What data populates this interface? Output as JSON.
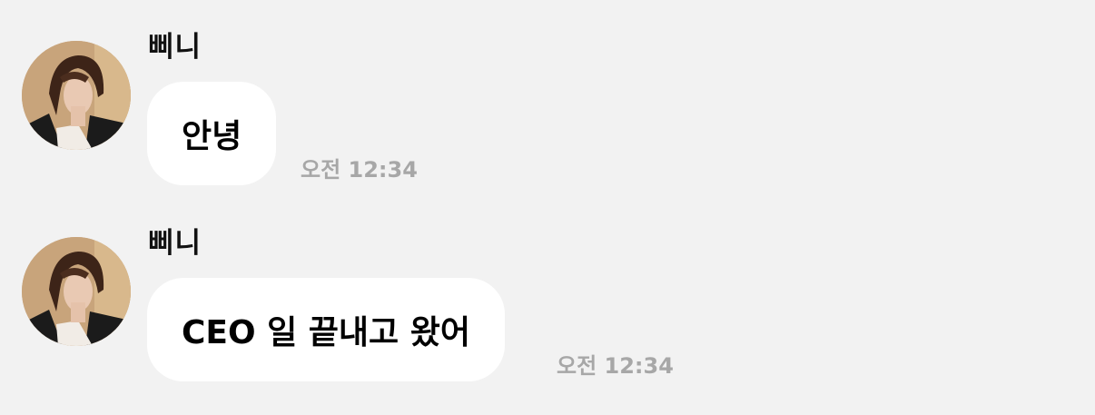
{
  "messages": [
    {
      "sender": "삐니",
      "text": "안녕",
      "time": "오전 12:34",
      "avatar_icon": "profile-photo"
    },
    {
      "sender": "삐니",
      "text": "CEO 일 끝내고 왔어",
      "time": "오전 12:34",
      "avatar_icon": "profile-photo"
    }
  ],
  "colors": {
    "background": "#f2f2f2",
    "bubble": "#ffffff",
    "timestamp": "#a7a7a7"
  }
}
